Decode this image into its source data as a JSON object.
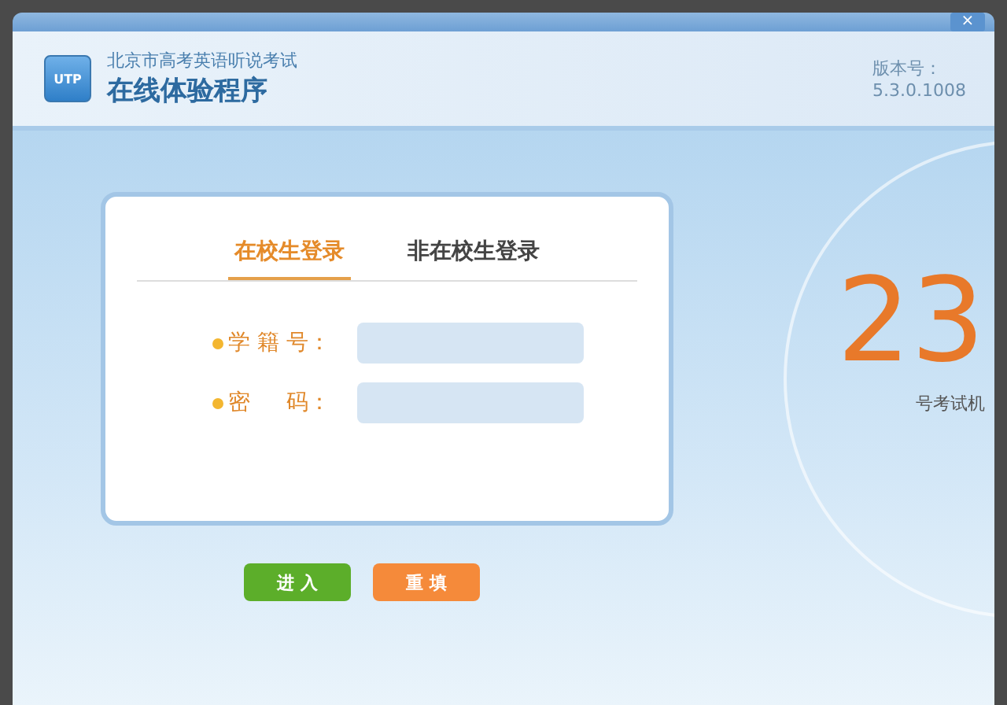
{
  "window": {
    "subtitle": "北京市高考英语听说考试",
    "title": "在线体验程序",
    "logo": "UTP",
    "version_label": "版本号：",
    "version": "5.3.0.1008",
    "close": "×"
  },
  "tabs": [
    {
      "label": "在校生登录",
      "selected": true
    },
    {
      "label": "非在校生登录",
      "selected": false
    }
  ],
  "fields": [
    {
      "label": "学 籍 号："
    },
    {
      "label": "密　  码："
    }
  ],
  "buttons": [
    {
      "label": "进 入",
      "kind": "primary"
    },
    {
      "label": "重 填",
      "kind": "secondary"
    }
  ],
  "machine": {
    "number": "23",
    "caption": "号考试机"
  }
}
